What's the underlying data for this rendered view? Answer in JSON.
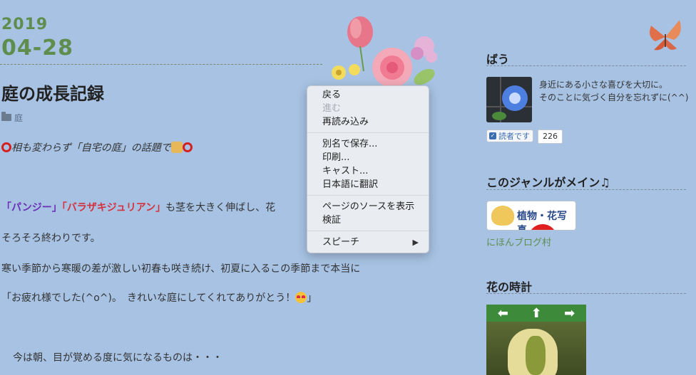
{
  "post": {
    "year": "2019",
    "month_day": "04-28",
    "title": "庭の成長記録",
    "category": "庭",
    "line1_text": "相も変わらず「自宅の庭」の話題で",
    "line2_pansy": "「パンジー」",
    "line2_rose": "「バラザキジュリアン」",
    "line2_rest": "も茎を大きく伸ばし、花",
    "line3": "そろそろ終わりです。",
    "line4": "寒い季節から寒暖の差が激しい初春も咲き続け、初夏に入るこの季節まで本当に",
    "line5": "「お疲れ様でした(^o^)。　きれいな庭にしてくれてありがとう！",
    "line5_end": "」",
    "line6": "今は朝、目が覚める度に気になるものは・・・"
  },
  "context_menu": {
    "items": [
      {
        "label": "戻る",
        "enabled": true
      },
      {
        "label": "進む",
        "enabled": false
      },
      {
        "label": "再読み込み",
        "enabled": true
      },
      {
        "label": "別名で保存...",
        "enabled": true
      },
      {
        "label": "印刷...",
        "enabled": true
      },
      {
        "label": "キャスト...",
        "enabled": true
      },
      {
        "label": "日本語に翻訳",
        "enabled": true
      },
      {
        "label": "ページのソースを表示",
        "enabled": true
      },
      {
        "label": "検証",
        "enabled": true
      },
      {
        "label": "スピーチ",
        "enabled": true
      }
    ],
    "submenu_arrow": "▶"
  },
  "sidebar": {
    "profile_heading": "ばう",
    "bio_line1": "身近にある小さな喜びを大切に。",
    "bio_line2": "そのことに気づく自分を忘れずに(^^)",
    "reader_button": "読者です",
    "reader_count": "226",
    "genre_heading": "このジャンルがメイン♫",
    "genre_banner_text": "植物・花写真",
    "blogmura_link": "にほんブログ村",
    "clock_heading": "花の時計",
    "clock_nav": [
      "⬅",
      "⬆",
      "➡"
    ]
  },
  "colors": {
    "background": "#a7c2e3",
    "date": "#5f8d4e",
    "pansy": "#6a2fb5",
    "rose": "#d4323e"
  }
}
